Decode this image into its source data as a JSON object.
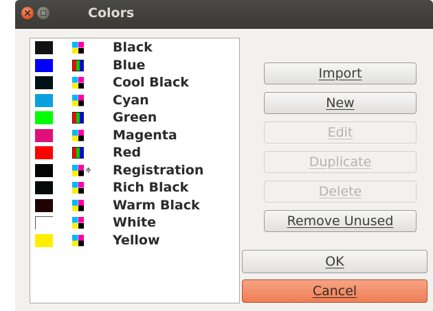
{
  "window": {
    "title": "Colors"
  },
  "colors": [
    {
      "name": "Black",
      "swatch": "#121212",
      "type": "cmyk",
      "registration": false
    },
    {
      "name": "Blue",
      "swatch": "#0000ff",
      "type": "rgb",
      "registration": false
    },
    {
      "name": "Cool Black",
      "swatch": "#001018",
      "type": "cmyk",
      "registration": false
    },
    {
      "name": "Cyan",
      "swatch": "#0aa0e0",
      "type": "cmyk",
      "registration": false
    },
    {
      "name": "Green",
      "swatch": "#00ff00",
      "type": "rgb",
      "registration": false
    },
    {
      "name": "Magenta",
      "swatch": "#e0107a",
      "type": "cmyk",
      "registration": false
    },
    {
      "name": "Red",
      "swatch": "#ff0000",
      "type": "rgb",
      "registration": false
    },
    {
      "name": "Registration",
      "swatch": "#050505",
      "type": "cmyk",
      "registration": true
    },
    {
      "name": "Rich Black",
      "swatch": "#060a08",
      "type": "cmyk",
      "registration": false
    },
    {
      "name": "Warm Black",
      "swatch": "#200404",
      "type": "cmyk",
      "registration": false
    },
    {
      "name": "White",
      "swatch": "#ffffff",
      "type": "cmyk",
      "registration": false
    },
    {
      "name": "Yellow",
      "swatch": "#ffee00",
      "type": "cmyk",
      "registration": false
    }
  ],
  "registration_mark": "⌖",
  "buttons": {
    "import": "Import",
    "new": "New",
    "edit": "Edit",
    "duplicate": "Duplicate",
    "delete": "Delete",
    "remove_unused": "Remove Unused",
    "ok": "OK",
    "cancel": "Cancel"
  }
}
